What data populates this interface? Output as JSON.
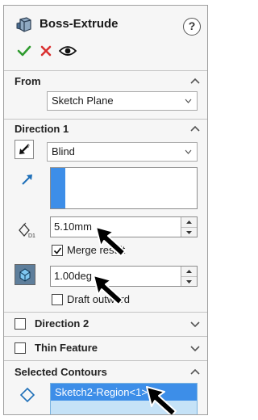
{
  "header": {
    "title": "Boss-Extrude",
    "help_label": "?"
  },
  "actions": {
    "ok_icon": "check-icon",
    "cancel_icon": "x-icon",
    "preview_icon": "eye-icon"
  },
  "from": {
    "label": "From",
    "value": "Sketch Plane"
  },
  "direction1": {
    "label": "Direction 1",
    "end_condition": "Blind",
    "depth": "5.10mm",
    "merge_label": "Merge result",
    "merge_checked": true,
    "draft_angle": "1.00deg",
    "draft_label": "Draft outward",
    "draft_checked": false
  },
  "direction2": {
    "label": "Direction 2",
    "checked": false
  },
  "thin_feature": {
    "label": "Thin Feature",
    "checked": false
  },
  "selected_contours": {
    "label": "Selected Contours",
    "item": "Sketch2-Region<1>"
  },
  "colors": {
    "ok_green": "#2f9b2f",
    "cancel_red": "#d93030",
    "selection_blue": "#3d8ee8",
    "field_blue": "#c5e2f7"
  }
}
